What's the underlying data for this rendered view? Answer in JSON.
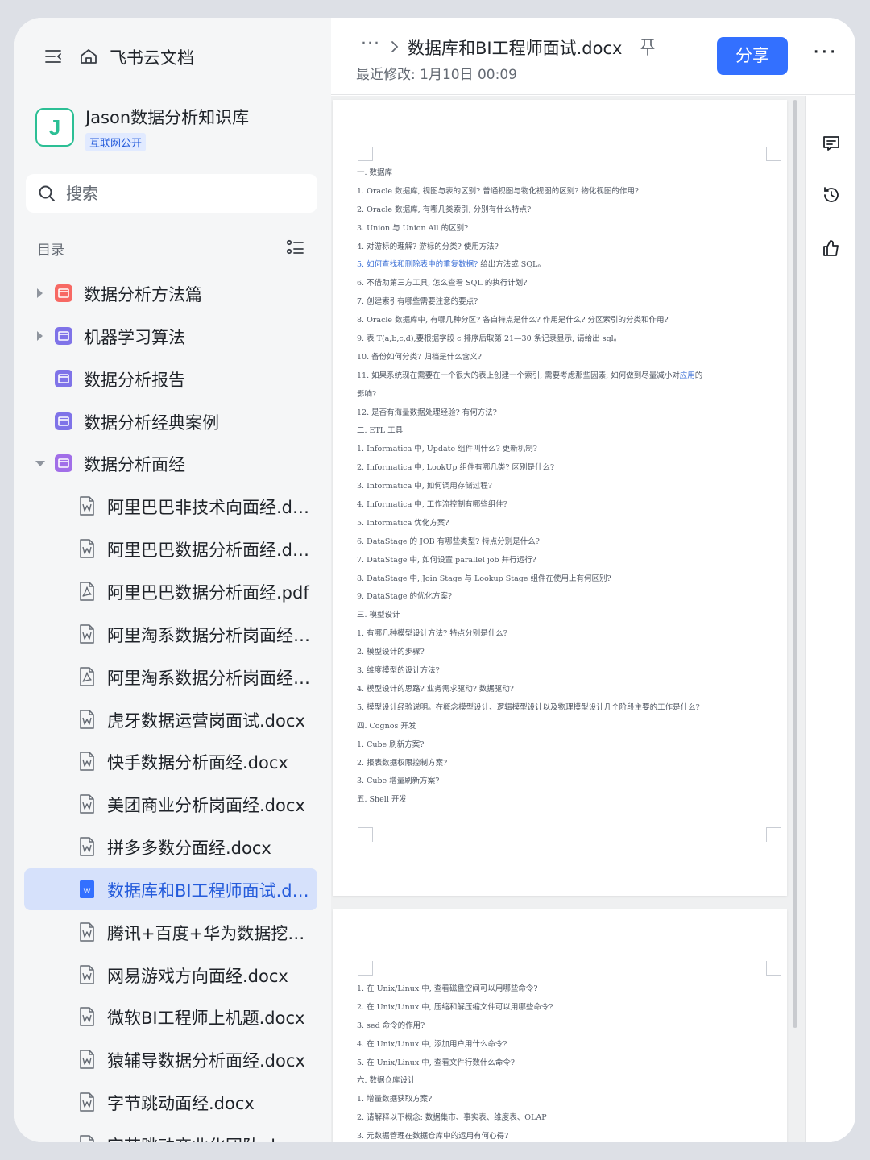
{
  "sidebar": {
    "app_title": "飞书云文档",
    "knowledge_base": {
      "avatar": "J",
      "name": "Jason数据分析知识库",
      "badge": "互联网公开"
    },
    "search": {
      "placeholder": "搜索"
    },
    "toc_label": "目录",
    "tree": [
      {
        "type": "folder",
        "label": "数据分析方法篇",
        "expand": "collapsed",
        "color": "#f76964"
      },
      {
        "type": "folder",
        "label": "机器学习算法",
        "expand": "collapsed",
        "color": "#7f73e8"
      },
      {
        "type": "folder",
        "label": "数据分析报告",
        "expand": "none",
        "color": "#7f73e8"
      },
      {
        "type": "folder",
        "label": "数据分析经典案例",
        "expand": "none",
        "color": "#7f73e8"
      },
      {
        "type": "folder",
        "label": "数据分析面经",
        "expand": "expanded",
        "color": "#a16ee8"
      },
      {
        "type": "docx",
        "label": "阿里巴巴非技术向面经.docx"
      },
      {
        "type": "docx",
        "label": "阿里巴巴数据分析面经.docx"
      },
      {
        "type": "pdf",
        "label": "阿里巴巴数据分析面经.pdf"
      },
      {
        "type": "docx",
        "label": "阿里淘系数据分析岗面经.d..."
      },
      {
        "type": "pdf",
        "label": "阿里淘系数据分析岗面经.p..."
      },
      {
        "type": "docx",
        "label": "虎牙数据运营岗面试.docx"
      },
      {
        "type": "docx",
        "label": "快手数据分析面经.docx"
      },
      {
        "type": "docx",
        "label": "美团商业分析岗面经.docx"
      },
      {
        "type": "docx",
        "label": "拼多多数分面经.docx"
      },
      {
        "type": "docx",
        "label": "数据库和BI工程师面试.docx",
        "selected": true
      },
      {
        "type": "docx",
        "label": "腾讯+百度+华为数据挖掘..."
      },
      {
        "type": "docx",
        "label": "网易游戏方向面经.docx"
      },
      {
        "type": "docx",
        "label": "微软BI工程师上机题.docx"
      },
      {
        "type": "docx",
        "label": "猿辅导数据分析面经.docx"
      },
      {
        "type": "docx",
        "label": "字节跳动面经.docx"
      },
      {
        "type": "docx",
        "label": "字节跳动商业化团队.docx"
      }
    ]
  },
  "header": {
    "breadcrumb_more": "···",
    "title": "数据库和BI工程师面试.docx",
    "modified": "最近修改: 1月10日 00:09",
    "share_label": "分享",
    "more_label": "···"
  },
  "document": {
    "page1": [
      "一. 数据库",
      "1. Oracle 数据库, 视图与表的区别? 普通视图与物化视图的区别? 物化视图的作用?",
      "2. Oracle 数据库, 有哪几类索引, 分别有什么特点?",
      "3. Union 与 Union  All 的区别?",
      "4. 对游标的理解? 游标的分类? 使用方法?",
      {
        "link": "5. 如何查找和删除表中的重复数据?",
        "rest": " 给出方法或 SQL。"
      },
      "6. 不借助第三方工具, 怎么查看 SQL 的执行计划?",
      "7. 创建索引有哪些需要注意的要点?",
      "8. Oracle 数据库中, 有哪几种分区? 各自特点是什么? 作用是什么? 分区索引的分类和作用?",
      "9. 表 T(a,b,c,d),要根据字段 c 排序后取第 21—30 条记录显示, 请给出 sql。",
      "10. 备份如何分类? 归档是什么含义?",
      {
        "pre": "11. 如果系统现在需要在一个很大的表上创建一个索引, 需要考虑那些因素, 如何做到尽量减小对",
        "ul": "应用",
        "post": "的"
      },
      "影响?",
      "12. 是否有海量数据处理经验? 有何方法?",
      "二. ETL 工具",
      "1. Informatica 中, Update 组件叫什么? 更新机制?",
      "2. Informatica 中, LookUp 组件有哪几类? 区别是什么?",
      "3. Informatica 中, 如何调用存储过程?",
      "4. Informatica 中, 工作流控制有哪些组件?",
      "5. Informatica 优化方案?",
      "6. DataStage 的 JOB 有哪些类型? 特点分别是什么?",
      "7. DataStage 中, 如何设置 parallel   job 并行运行?",
      "8. DataStage 中, Join  Stage  与  Lookup  Stage 组件在使用上有何区别?",
      "9. DataStage 的优化方案?",
      "三. 模型设计",
      "1. 有哪几种模型设计方法? 特点分别是什么?",
      "2. 模型设计的步骤?",
      "3. 维度模型的设计方法?",
      "4. 模型设计的思路? 业务需求驱动? 数据驱动?",
      "5. 模型设计经验说明。在概念模型设计、逻辑模型设计以及物理模型设计几个阶段主要的工作是什么?",
      "四. Cognos 开发",
      "1. Cube 刷新方案?",
      "2. 报表数据权限控制方案?",
      "3. Cube 增量刷新方案?",
      "五. Shell 开发"
    ],
    "page2": [
      "1. 在 Unix/Linux 中, 查看磁盘空间可以用哪些命令?",
      "2. 在 Unix/Linux 中, 压缩和解压缩文件可以用哪些命令?",
      "3. sed 命令的作用?",
      "4. 在 Unix/Linux 中, 添加用户用什么命令?",
      "5. 在 Unix/Linux 中, 查看文件行数什么命令?",
      "六. 数据仓库设计",
      "1. 增量数据获取方案?",
      "2. 请解释以下概念: 数据集市、事实表、维度表、OLAP",
      "3. 元数据管理在数据仓库中的运用有何心得?"
    ]
  },
  "colors": {
    "accent": "#3370ff",
    "selected_bg": "#d6e1fb",
    "selected_text": "#245bdb",
    "kb_avatar": "#2cbf95"
  }
}
